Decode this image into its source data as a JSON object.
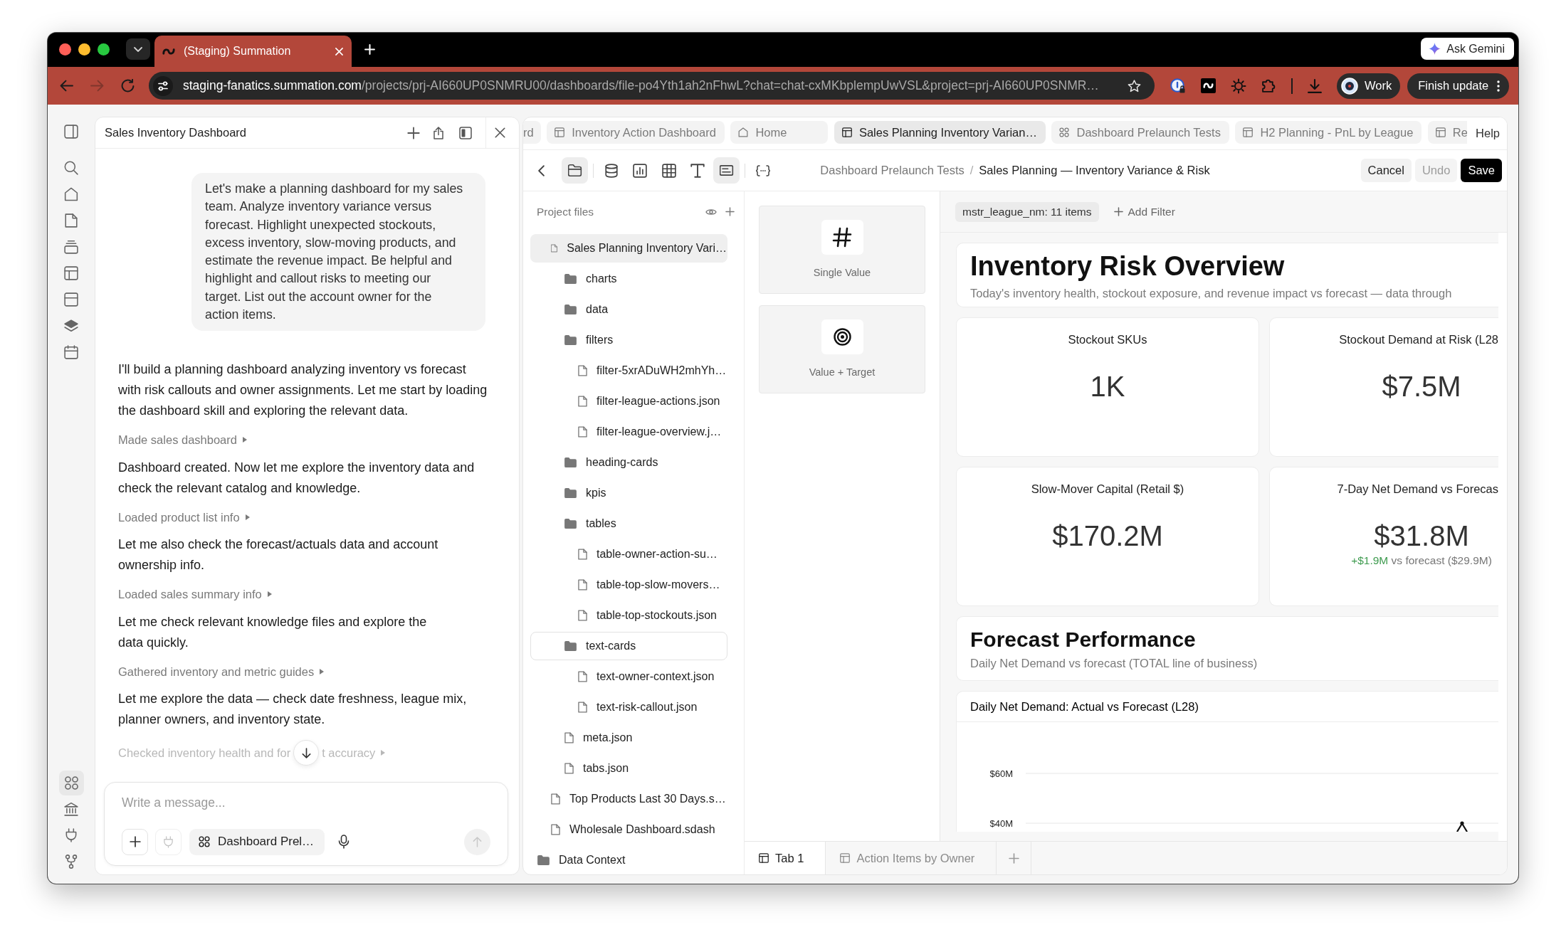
{
  "browser": {
    "tabs": [
      {
        "title": "(Staging) Summation",
        "selected": true
      }
    ],
    "ask_button": "Ask Gemini",
    "forward_disabled": true,
    "url": {
      "host": "staging-fanatics.summation.com",
      "path": "/projects/prj-AI660UP0SNMRU00/dashboards/file-po4Yth1ah2nFhwL?chat=chat-cxMKbplempUwVSL&project=prj-AI660UP0SNMR…"
    },
    "profile": "Work",
    "update_button": "Finish update"
  },
  "rail": {
    "top": [
      {
        "selected": false
      },
      {
        "selected": false
      },
      {
        "selected": false
      },
      {
        "selected": false
      },
      {
        "selected": false
      },
      {
        "selected": false
      },
      {
        "selected": false
      },
      {
        "selected": false
      },
      {
        "selected": false
      }
    ],
    "bottom": [
      {
        "selected": true
      },
      {
        "selected": false
      },
      {
        "selected": false
      },
      {
        "selected": false
      }
    ]
  },
  "chat": {
    "title": "Sales Inventory Dashboard",
    "messages": [
      {
        "kind": "user",
        "text": "Let's make a planning dashboard for my sales team. Analyze inventory variance versus forecast. Highlight unexpected stockouts, excess inventory, slow-moving products, and estimate the revenue impact. Be helpful and highlight and callout risks to meeting our target. List out the account owner for the action items."
      },
      {
        "kind": "assistant",
        "text": "I'll build a planning dashboard analyzing inventory vs forecast with risk callouts and owner assignments. Let me start by loading the dashboard skill and exploring the relevant data."
      },
      {
        "kind": "step",
        "text": "Made sales dashboard",
        "faded": false
      },
      {
        "kind": "assistant",
        "text": "Dashboard created. Now let me explore the inventory data and check the relevant catalog and knowledge."
      },
      {
        "kind": "step",
        "text": "Loaded product list info",
        "faded": false
      },
      {
        "kind": "assistant",
        "text": "Let me also check the forecast/actuals data and account ownership info."
      },
      {
        "kind": "step",
        "text": "Loaded sales summary info",
        "faded": false
      },
      {
        "kind": "assistant",
        "text": "Let me check relevant knowledge files and explore the\ndata quickly."
      },
      {
        "kind": "step",
        "text": "Gathered inventory and metric guides",
        "faded": false
      },
      {
        "kind": "assistant",
        "text": "Let me explore the data — check date freshness, league mix, planner owners, and inventory state."
      },
      {
        "kind": "step",
        "text": "Checked inventory health and for",
        "text_after": "t accuracy",
        "faded": true
      }
    ],
    "scroll_down_button": true,
    "composer": {
      "placeholder": "Write a message...",
      "connector_disabled": true,
      "context_chip": "Dashboard Prel…",
      "send_disabled": true
    }
  },
  "workspace": {
    "tabs": [
      {
        "label": "rd",
        "kind": "text",
        "selected": false
      },
      {
        "label": "Inventory Action Dashboard",
        "kind": "dashboard",
        "selected": false
      },
      {
        "label": "Home",
        "kind": "home",
        "selected": false
      },
      {
        "label": "Sales Planning Inventory Varian…",
        "kind": "dashboard",
        "selected": true
      },
      {
        "label": "Dashboard Prelaunch Tests",
        "kind": "project",
        "selected": false
      },
      {
        "label": "H2 Planning - PnL by League",
        "kind": "dashboard",
        "selected": false
      },
      {
        "label": "Re",
        "kind": "dashboard",
        "selected": false
      }
    ],
    "help_label": "Help",
    "tools": [
      {
        "selected": true
      },
      {
        "selected": false
      },
      {
        "selected": false
      },
      {
        "selected": false
      },
      {
        "selected": false
      },
      {
        "selected": true
      },
      {
        "selected": false
      }
    ],
    "breadcrumb": {
      "parent": "Dashboard Prelaunch Tests",
      "separator": "/",
      "current": "Sales Planning — Inventory Variance & Risk"
    },
    "actions": [
      {
        "label": "Cancel",
        "kind": "secondary",
        "disabled": false
      },
      {
        "label": "Undo",
        "kind": "secondary",
        "disabled": true
      },
      {
        "label": "Save",
        "kind": "primary",
        "disabled": false
      }
    ],
    "files": {
      "title": "Project files",
      "items": [
        {
          "label": "Sales Planning Inventory Vari…",
          "kind": "file",
          "selected": true,
          "focused": false,
          "children": [
            {
              "label": "charts",
              "kind": "folder",
              "selected": false,
              "focused": false
            },
            {
              "label": "data",
              "kind": "folder",
              "selected": false,
              "focused": false
            },
            {
              "label": "filters",
              "kind": "folder",
              "selected": false,
              "focused": false,
              "children": [
                {
                  "label": "filter-5xrADuWH2mhYh…",
                  "kind": "file",
                  "selected": false,
                  "focused": false
                },
                {
                  "label": "filter-league-actions.json",
                  "kind": "file",
                  "selected": false,
                  "focused": false
                },
                {
                  "label": "filter-league-overview.j…",
                  "kind": "file",
                  "selected": false,
                  "focused": false
                }
              ]
            },
            {
              "label": "heading-cards",
              "kind": "folder",
              "selected": false,
              "focused": false
            },
            {
              "label": "kpis",
              "kind": "folder",
              "selected": false,
              "focused": false
            },
            {
              "label": "tables",
              "kind": "folder",
              "selected": false,
              "focused": false,
              "children": [
                {
                  "label": "table-owner-action-su…",
                  "kind": "file",
                  "selected": false,
                  "focused": false
                },
                {
                  "label": "table-top-slow-movers…",
                  "kind": "file",
                  "selected": false,
                  "focused": false
                },
                {
                  "label": "table-top-stockouts.json",
                  "kind": "file",
                  "selected": false,
                  "focused": false
                }
              ]
            },
            {
              "label": "text-cards",
              "kind": "folder",
              "selected": false,
              "focused": true,
              "children": [
                {
                  "label": "text-owner-context.json",
                  "kind": "file",
                  "selected": false,
                  "focused": false
                },
                {
                  "label": "text-risk-callout.json",
                  "kind": "file",
                  "selected": false,
                  "focused": false
                }
              ]
            },
            {
              "label": "meta.json",
              "kind": "file",
              "selected": false,
              "focused": false
            },
            {
              "label": "tabs.json",
              "kind": "file",
              "selected": false,
              "focused": false
            }
          ]
        },
        {
          "label": "Top Products Last 30 Days.s…",
          "kind": "file",
          "selected": false,
          "focused": false
        },
        {
          "label": "Wholesale Dashboard.sdash",
          "kind": "file",
          "selected": false,
          "focused": false
        }
      ]
    },
    "data_context": {
      "label": "Data Context",
      "kind": "folder",
      "selected": false,
      "focused": false
    },
    "widgets": [
      {
        "label": "Single Value"
      },
      {
        "label": "Value + Target"
      }
    ],
    "dashboard": {
      "filters": [
        {
          "label": "mstr_league_nm: 11 items"
        }
      ],
      "add_filter": "Add Filter",
      "blocks": [
        {
          "kind": "page_heading",
          "title": "Inventory Risk Overview",
          "subtitle": "Today's inventory health, stockout exposure, and revenue impact vs forecast — data through"
        },
        {
          "kind": "kpis",
          "cards": [
            {
              "label": "Stockout SKUs",
              "value": "1K"
            },
            {
              "label": "Stockout Demand at Risk (L28",
              "value": "$7.5M"
            },
            {
              "label": "Slow-Mover Capital (Retail $)",
              "value": "$170.2M"
            },
            {
              "label": "7-Day Net Demand vs Forecas",
              "value": "$31.8M",
              "delta": "+$1.9M",
              "delta_note": "vs forecast ($29.9M)",
              "positive": true
            }
          ]
        },
        {
          "kind": "section_heading",
          "title": "Forecast Performance",
          "subtitle": "Daily Net Demand vs forecast (TOTAL line of business)"
        },
        {
          "kind": "chart",
          "title": "Daily Net Demand: Actual vs Forecast (L28)",
          "tick_labels": [
            "$60M",
            "$40M"
          ]
        }
      ]
    },
    "sheet_tabs": [
      {
        "label": "Tab 1",
        "selected": true
      },
      {
        "label": "Action Items by Owner",
        "selected": false
      }
    ]
  }
}
